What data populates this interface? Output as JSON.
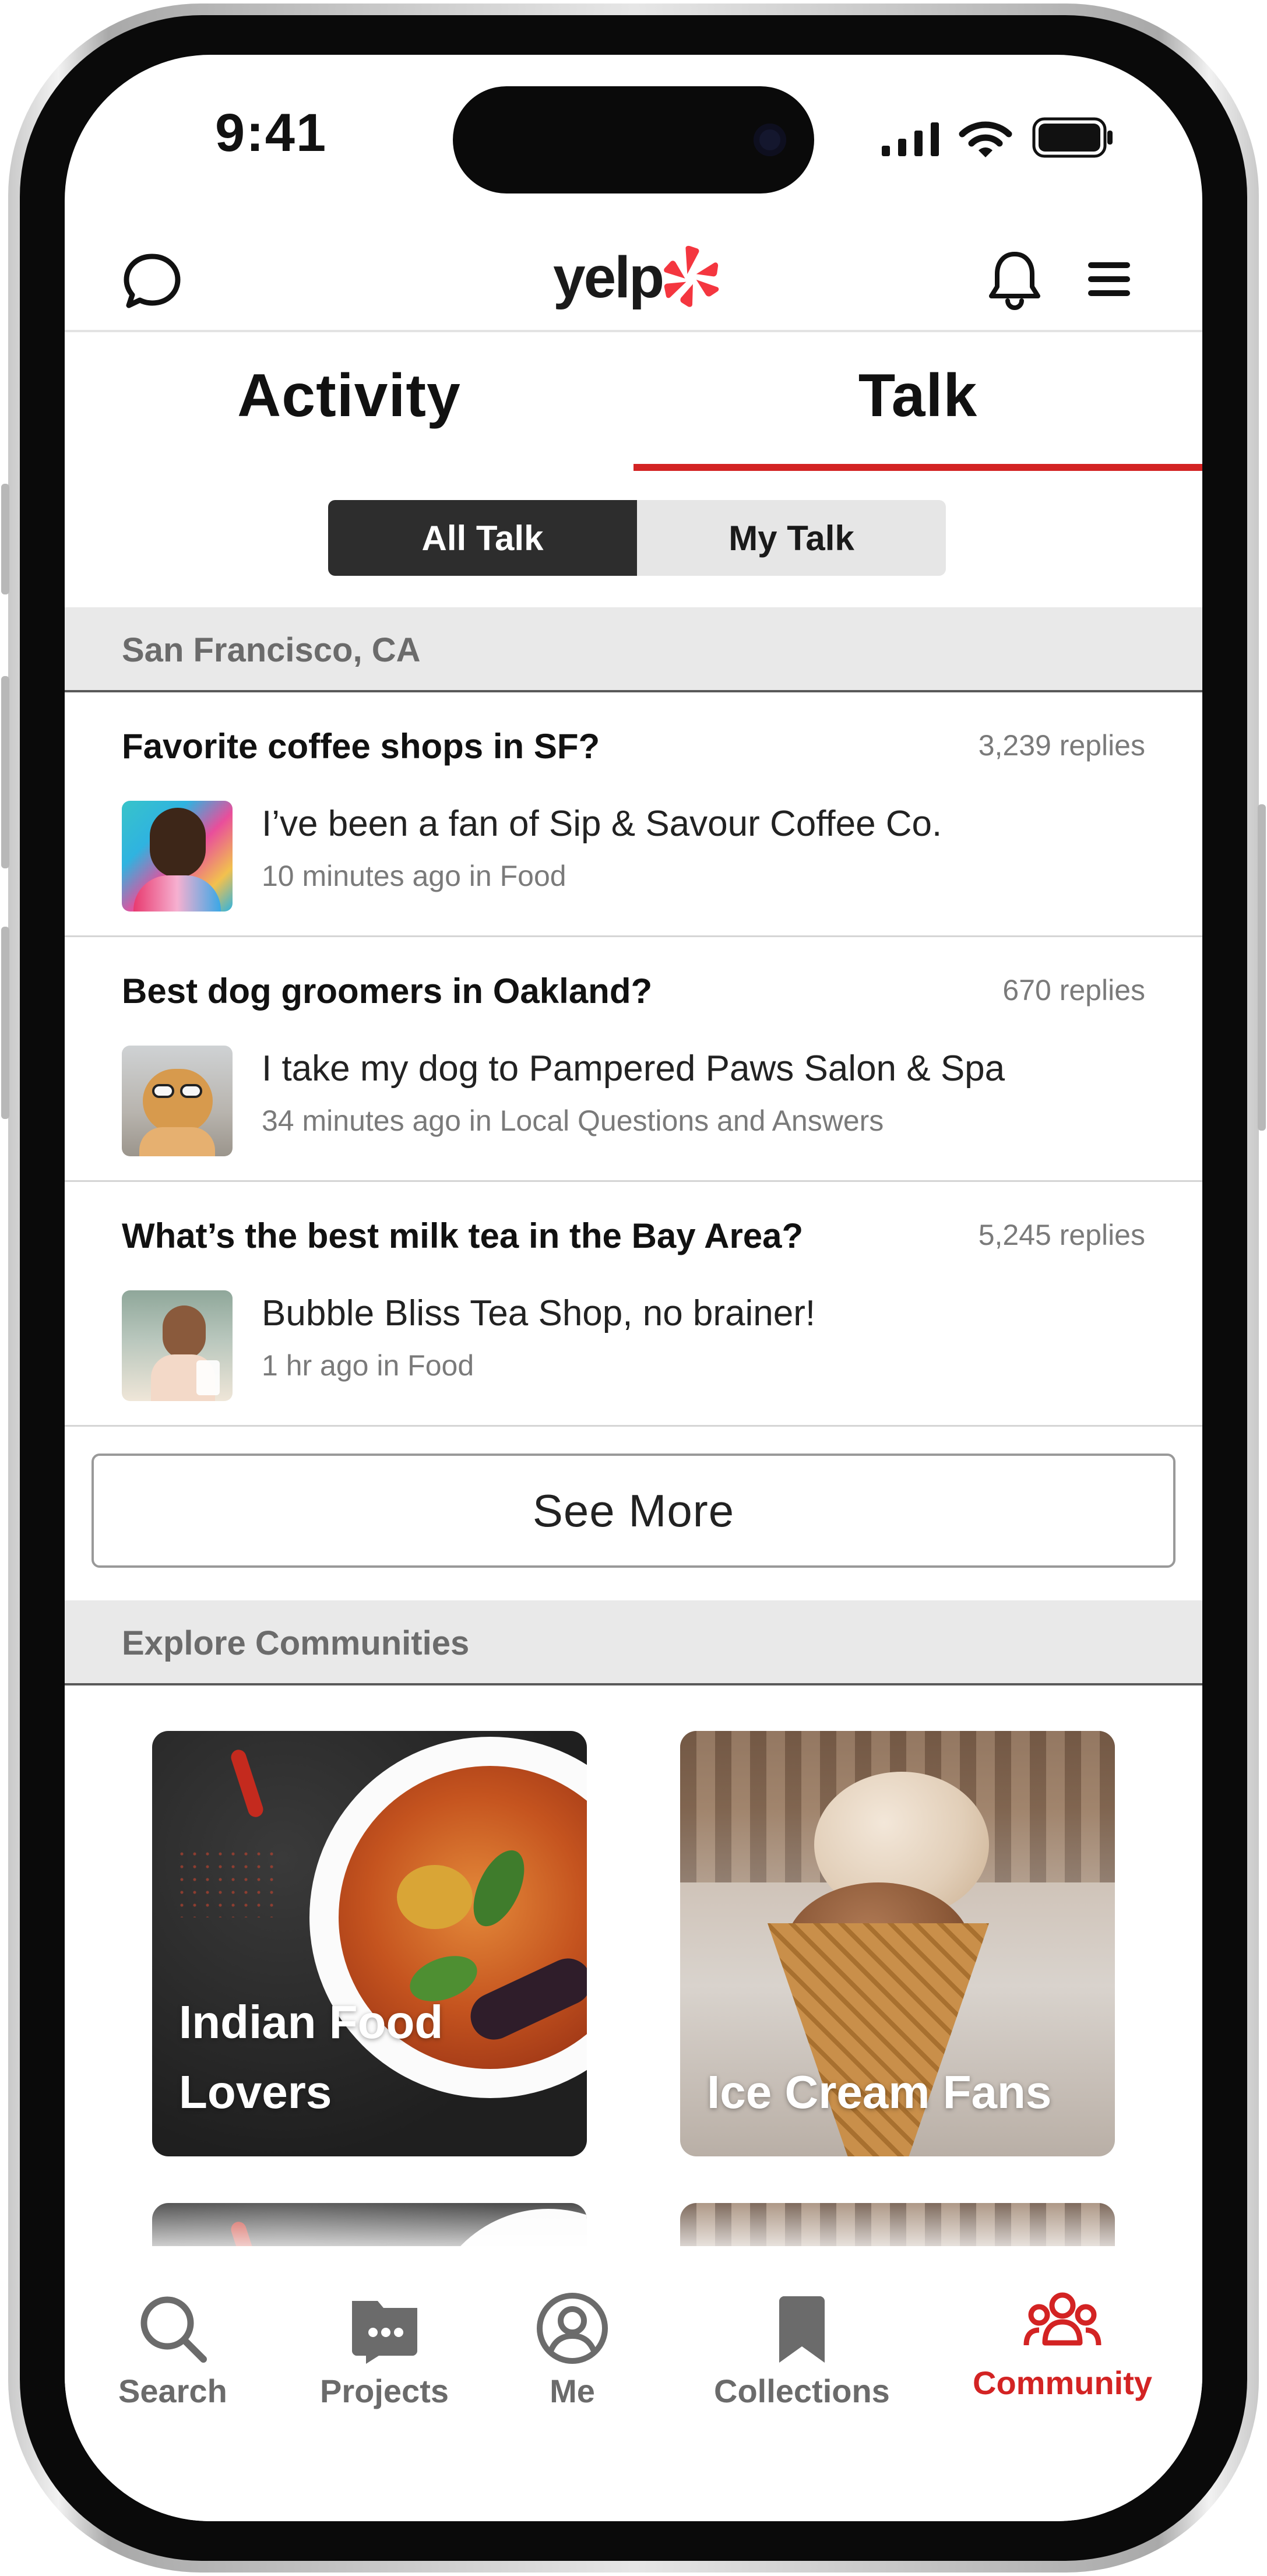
{
  "status_bar": {
    "time": "9:41"
  },
  "header": {
    "logo_text": "yelp",
    "icons": [
      "chat-bubble-icon",
      "bell-icon",
      "menu-icon"
    ]
  },
  "tabs": [
    {
      "label": "Activity",
      "active": false
    },
    {
      "label": "Talk",
      "active": true
    }
  ],
  "talk_filter": {
    "options": [
      "All Talk",
      "My Talk"
    ],
    "selected": "All Talk"
  },
  "location_section": {
    "title": "San Francisco, CA"
  },
  "threads": [
    {
      "title": "Favorite coffee shops in SF?",
      "replies": "3,239 replies",
      "snippet": "I’ve been a fan of Sip & Savour Coffee Co.",
      "meta": "10 minutes ago in Food"
    },
    {
      "title": "Best dog groomers in Oakland?",
      "replies": "670 replies",
      "snippet": "I take my dog to Pampered Paws Salon & Spa",
      "meta": "34 minutes ago in Local Questions and Answers"
    },
    {
      "title": "What’s the best milk tea in the Bay Area?",
      "replies": "5,245 replies",
      "snippet": "Bubble Bliss Tea Shop, no brainer!",
      "meta": "1 hr ago in Food"
    }
  ],
  "see_more_label": "See More",
  "communities_section": {
    "title": "Explore Communities",
    "cards": [
      {
        "line1": "Indian Food",
        "line2": "Lovers"
      },
      {
        "line1": "",
        "line2": "Ice Cream Fans"
      }
    ]
  },
  "bottom_nav": {
    "items": [
      {
        "label": "Search",
        "icon": "search-icon"
      },
      {
        "label": "Projects",
        "icon": "projects-icon"
      },
      {
        "label": "Me",
        "icon": "profile-icon"
      },
      {
        "label": "Collections",
        "icon": "bookmark-icon"
      },
      {
        "label": "Community",
        "icon": "community-icon"
      }
    ],
    "active": "Community"
  },
  "colors": {
    "brand_red": "#d32323",
    "segment_active": "#2d2d2d",
    "text_gray": "#7a7a7a"
  }
}
